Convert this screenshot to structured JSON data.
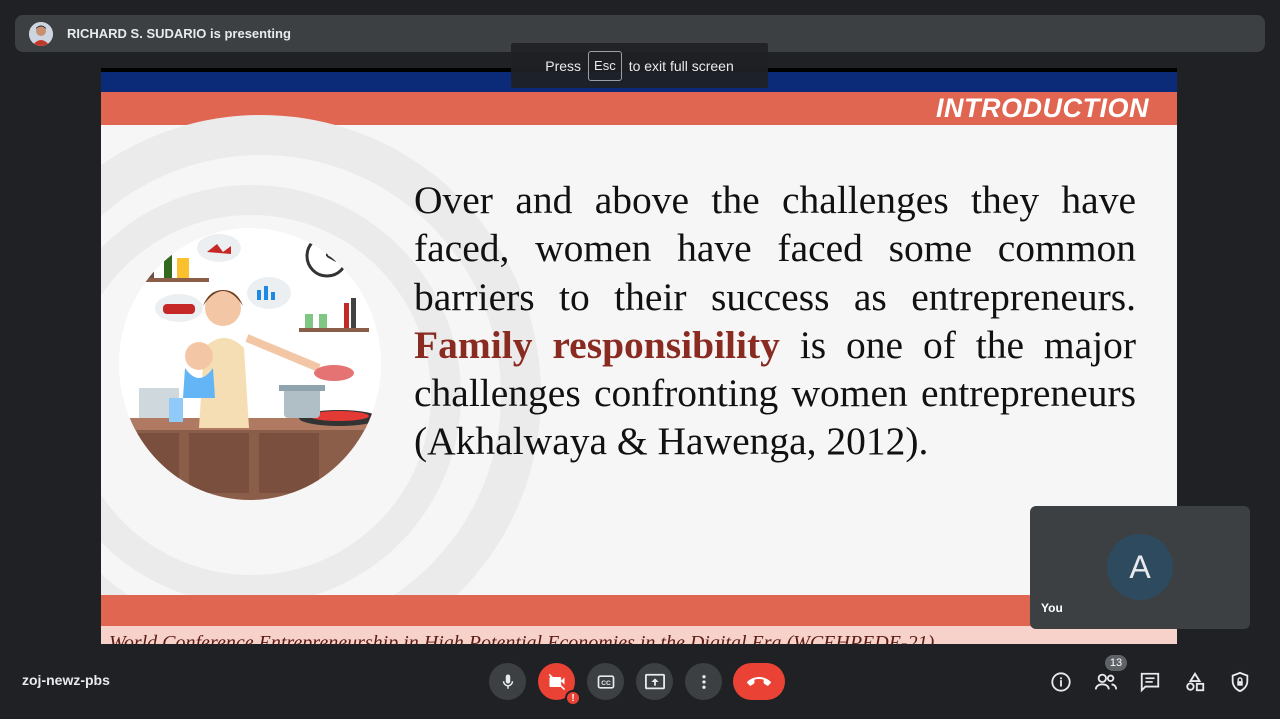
{
  "presenting": {
    "text": "RICHARD S. SUDARIO is presenting"
  },
  "fullscreen_hint": {
    "press": "Press",
    "key": "Esc",
    "rest": "to exit full screen"
  },
  "slide": {
    "title": "INTRODUCTION",
    "body_before": "Over and above the challenges they have faced, women have faced some common barriers to their success as entrepreneurs.",
    "body_highlight": "Family responsibility",
    "body_after": "is one of the major challenges confronting women entrepreneurs (Akhalwaya & Hawenga, 2012).",
    "footer": "World Conference Entrepreneurship in High Potential Economies in the Digital Era (WCEHPEDE-21)",
    "colors": {
      "header_band": "#e06652",
      "top_band": "#0b2a78",
      "highlight": "#8a2b22"
    }
  },
  "self_view": {
    "initial": "A",
    "label": "You",
    "avatar_color": "#2e4a5e"
  },
  "meeting": {
    "code": "zoj-newz-pbs"
  },
  "controls": {
    "mic": "mic-icon",
    "camera_off": "camera-off-icon",
    "camera_alert": "!",
    "captions": "CC",
    "present": "present-screen-icon",
    "more": "more-vert-icon",
    "leave": "hang-up-icon"
  },
  "right_controls": {
    "participants_count": "13"
  }
}
